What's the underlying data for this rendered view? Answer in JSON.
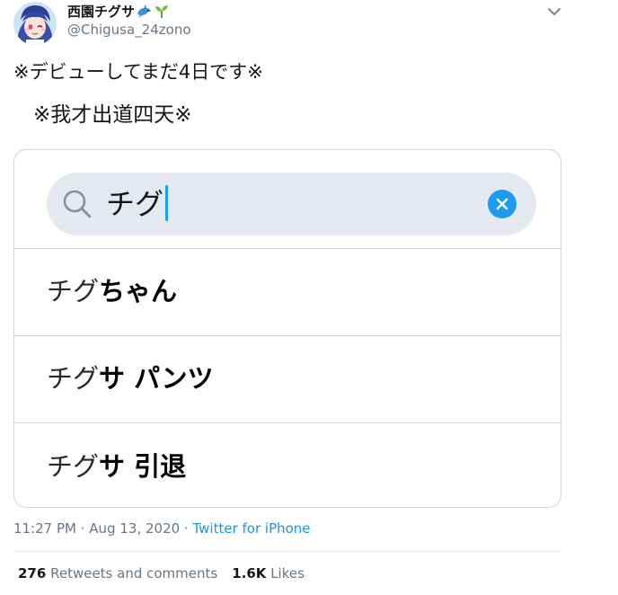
{
  "author": {
    "display_name": "西園チグサ",
    "emoji": [
      "dolphin-emoji",
      "seedling-emoji"
    ],
    "handle": "@Chigusa_24zono"
  },
  "tweet": {
    "line1": "※デビューしてまだ4日です※",
    "line2": "※我才出道四天※"
  },
  "media": {
    "search": {
      "query": "チグ"
    },
    "suggestions": [
      {
        "match": "チグ",
        "rest": "ちゃん"
      },
      {
        "match": "チグ",
        "rest": "サ パンツ"
      },
      {
        "match": "チグ",
        "rest": "サ 引退"
      }
    ]
  },
  "meta": {
    "time": "11:27 PM",
    "separator": " · ",
    "date": "Aug 13, 2020",
    "source": "Twitter for iPhone"
  },
  "stats": {
    "retweets_count": "276",
    "retweets_label": "Retweets and comments",
    "likes_count": "1.6K",
    "likes_label": "Likes"
  },
  "colors": {
    "link": "#1b95e0",
    "muted": "#657786",
    "cursor": "#1da1f2",
    "clear_button": "#1d9bf0"
  }
}
